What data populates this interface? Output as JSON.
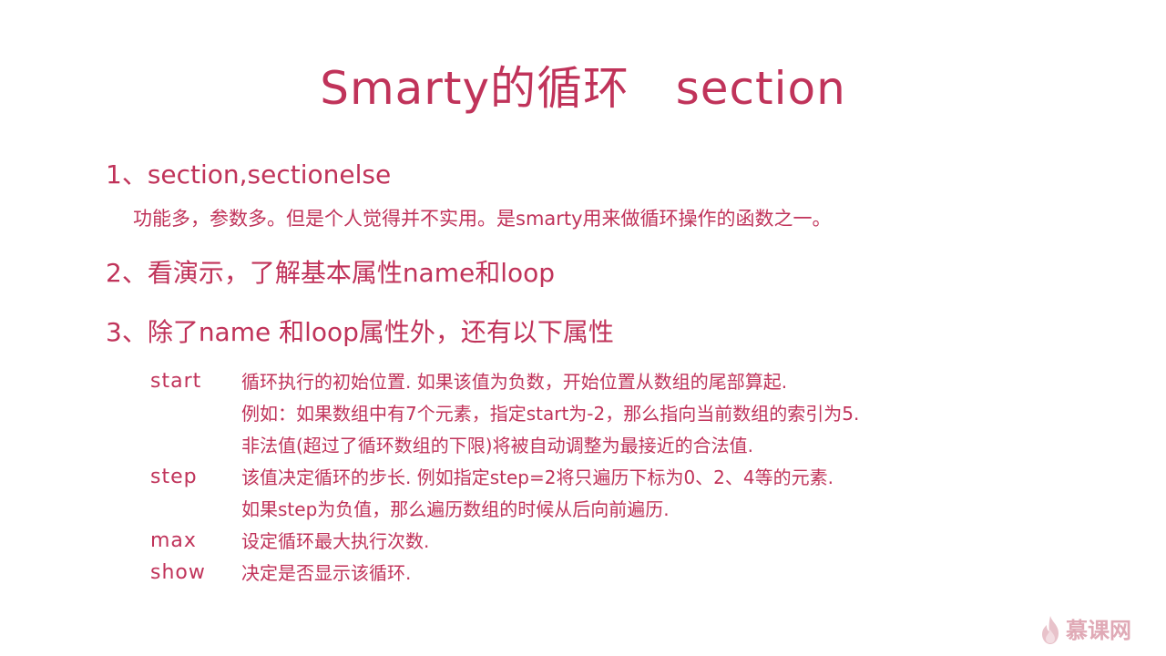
{
  "title": "Smarty的循环   section",
  "items": [
    {
      "heading": "1、section,sectionelse",
      "desc": "功能多，参数多。但是个人觉得并不实用。是smarty用来做循环操作的函数之一。"
    },
    {
      "heading": "2、看演示，了解基本属性name和loop"
    },
    {
      "heading": "3、除了name 和loop属性外，还有以下属性"
    }
  ],
  "properties": [
    {
      "term": "start",
      "lines": [
        "循环执行的初始位置. 如果该值为负数，开始位置从数组的尾部算起.",
        "例如：如果数组中有7个元素，指定start为-2，那么指向当前数组的索引为5.",
        "非法值(超过了循环数组的下限)将被自动调整为最接近的合法值."
      ]
    },
    {
      "term": "step",
      "lines": [
        "该值决定循环的步长. 例如指定step=2将只遍历下标为0、2、4等的元素.",
        "如果step为负值，那么遍历数组的时候从后向前遍历."
      ]
    },
    {
      "term": "max",
      "lines": [
        "设定循环最大执行次数."
      ]
    },
    {
      "term": "show",
      "lines": [
        "决定是否显示该循环."
      ]
    }
  ],
  "logo": {
    "text": "慕课网",
    "icon": "flame-icon"
  },
  "colors": {
    "text": "#c0335a",
    "logo": "#e3b3bd",
    "background": "#ffffff"
  }
}
